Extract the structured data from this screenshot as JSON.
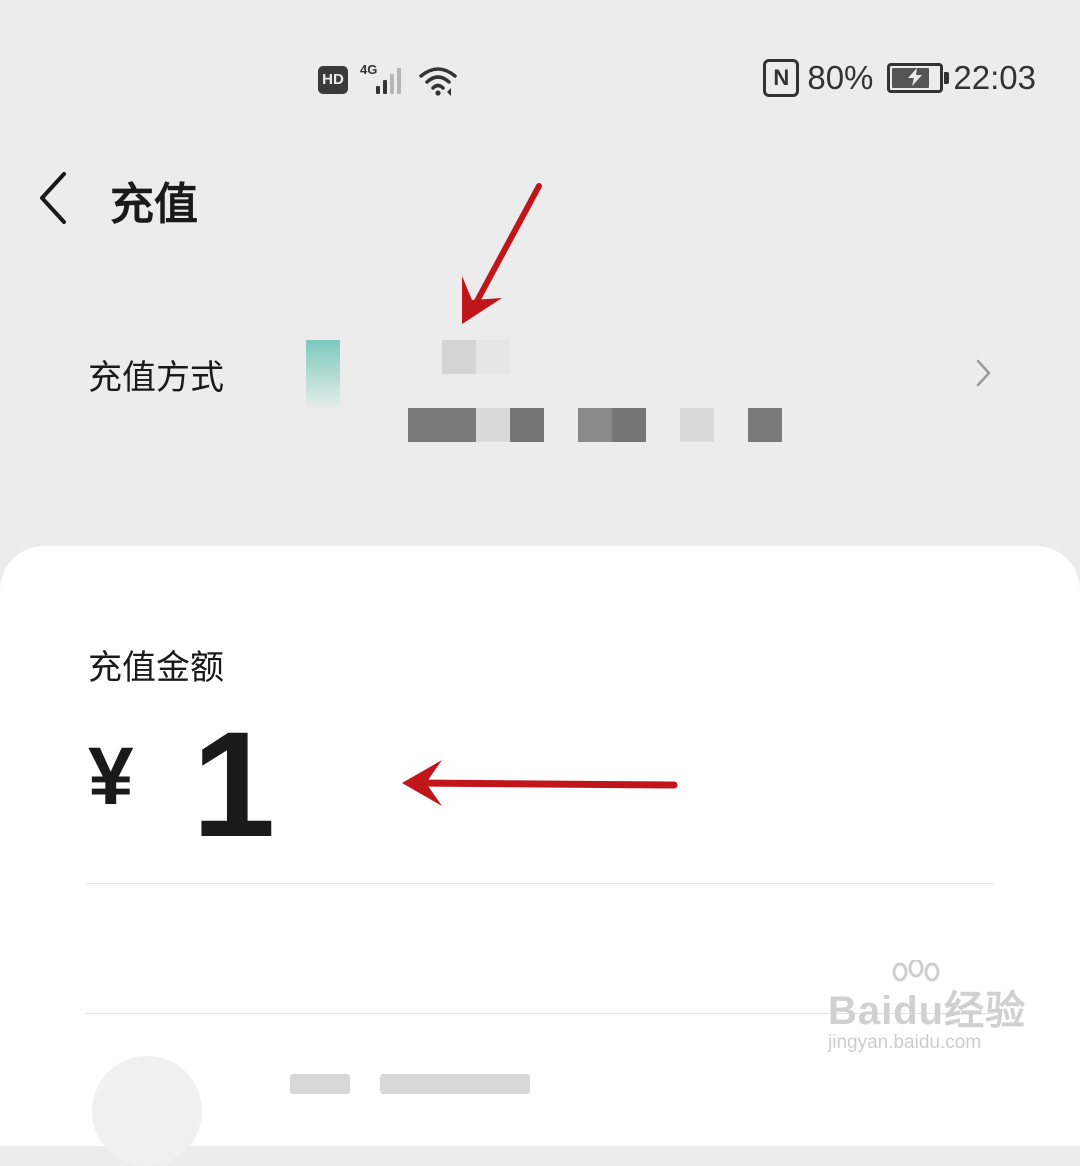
{
  "status_bar": {
    "network_badge": "HD",
    "network_type": "4G",
    "icons": [
      "hd-icon",
      "signal-icon",
      "wifi-icon",
      "nfc-icon",
      "battery-charging-icon"
    ],
    "nfc_glyph": "N",
    "battery_percent": "80%",
    "battery_level": 0.8,
    "time": "22:03"
  },
  "header": {
    "back_icon": "chevron-left-icon",
    "title": "充值"
  },
  "payment_method": {
    "label": "充值方式",
    "chevron_icon": "chevron-right-icon"
  },
  "amount": {
    "label": "充值金额",
    "currency": "¥",
    "value": "1"
  },
  "watermark": {
    "brand": "Baidu经验",
    "url": "jingyan.baidu.com"
  },
  "colors": {
    "background": "#ececec",
    "sheet": "#ffffff",
    "text": "#1a1a1a",
    "annotation_arrow": "#c0161b"
  }
}
